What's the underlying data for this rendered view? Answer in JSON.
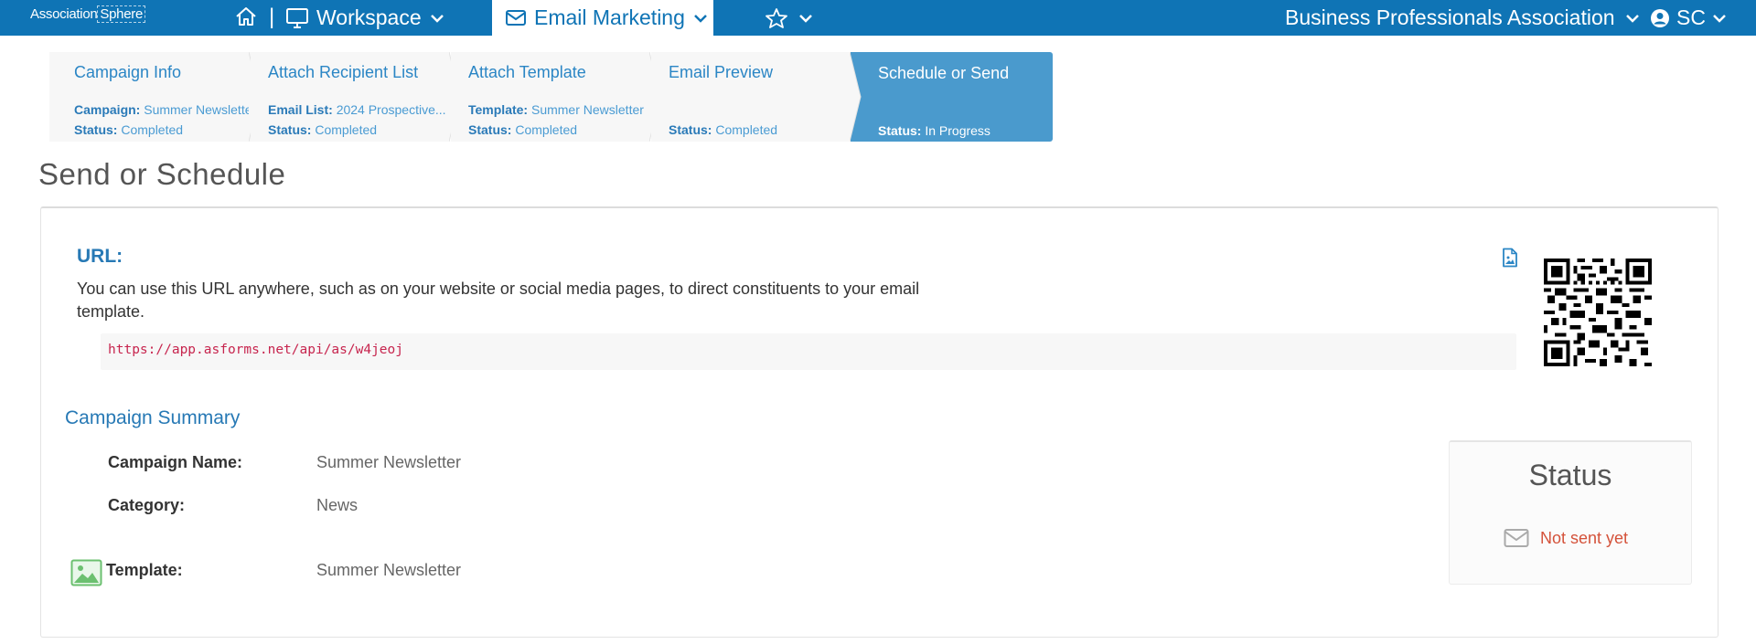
{
  "nav": {
    "logo_text_1": "Association",
    "logo_text_2": "Sphere",
    "separator": "|",
    "workspace_label": "Workspace",
    "email_marketing_label": "Email Marketing",
    "org_name": "Business Professionals Association",
    "user_initials": "SC",
    "icons": [
      "home-icon",
      "monitor-icon",
      "envelope-icon",
      "star-icon",
      "chevron-down-icon",
      "user-circle-icon"
    ]
  },
  "wizard": {
    "steps": [
      {
        "title": "Campaign Info",
        "line1_label": "Campaign:",
        "line1_value": "Summer Newsletter",
        "line2_label": "Status:",
        "line2_value": "Completed"
      },
      {
        "title": "Attach Recipient List",
        "line1_label": "Email List:",
        "line1_value": "2024 Prospective...",
        "line2_label": "Status:",
        "line2_value": "Completed"
      },
      {
        "title": "Attach Template",
        "line1_label": "Template:",
        "line1_value": "Summer Newsletter",
        "line2_label": "Status:",
        "line2_value": "Completed"
      },
      {
        "title": "Email Preview",
        "line1_label": "",
        "line1_value": "",
        "line2_label": "Status:",
        "line2_value": "Completed"
      },
      {
        "title": "Schedule or Send",
        "line1_label": "",
        "line1_value": "",
        "line2_label": "Status:",
        "line2_value": "In Progress"
      }
    ],
    "active_step": 4
  },
  "page_title": "Send or Schedule",
  "url_section": {
    "heading": "URL:",
    "description": "You can use this URL anywhere, such as on your website or social media pages, to direct constituents to your email template.",
    "url": "https://app.asforms.net/api/as/w4jeoj"
  },
  "summary": {
    "heading": "Campaign Summary",
    "rows": [
      {
        "label": "Campaign Name:",
        "value": "Summer Newsletter"
      },
      {
        "label": "Category:",
        "value": "News"
      },
      {
        "label": "Template:",
        "value": "Summer Newsletter"
      }
    ]
  },
  "status": {
    "title": "Status",
    "text": "Not sent yet",
    "color": "#d4523a"
  },
  "colors": {
    "brand": "#0f74b5",
    "link": "#2b86c5",
    "active_step": "#4a9acd",
    "url_text": "#c7254e"
  }
}
